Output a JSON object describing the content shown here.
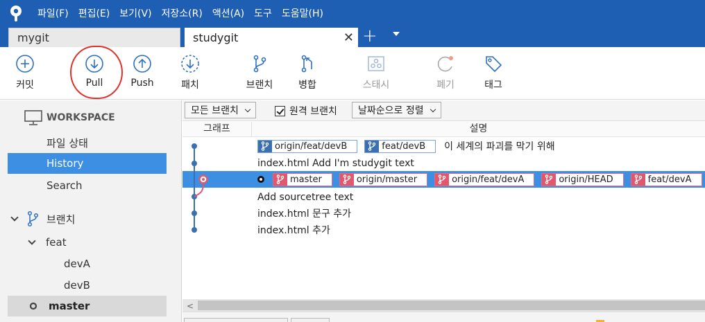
{
  "menu": [
    "파일(F)",
    "편집(E)",
    "보기(V)",
    "저장소(R)",
    "액션(A)",
    "도구",
    "도움말(H)"
  ],
  "tabs": [
    {
      "label": "mygit",
      "active": false
    },
    {
      "label": "studygit",
      "active": true
    }
  ],
  "tab_close_glyph": "✕",
  "tab_add_glyph": "+",
  "toolbar": {
    "commit": "커밋",
    "pull": "Pull",
    "push": "Push",
    "fetch": "패치",
    "branch": "브랜치",
    "merge": "병합",
    "stash": "스태시",
    "discard": "폐기",
    "tag": "태그"
  },
  "sidebar": {
    "workspace": "WORKSPACE",
    "file_status": "파일 상태",
    "history": "History",
    "search": "Search",
    "branches": "브랜치",
    "feat": "feat",
    "devA": "devA",
    "devB": "devB",
    "master": "master"
  },
  "filter": {
    "all_branches": "모든 브랜치",
    "remote_branches": "원격 브랜치",
    "sort": "날짜순으로 정렬"
  },
  "columns": {
    "graph": "그래프",
    "description": "설명"
  },
  "commits": [
    {
      "badges": [
        {
          "label": "origin/feat/devB",
          "color": "blue"
        },
        {
          "label": "feat/devB",
          "color": "blue"
        }
      ],
      "message": "이 세계의 파괴를 막기 위해",
      "selected": false
    },
    {
      "badges": [],
      "message": "index.html Add I'm studygit text",
      "selected": false
    },
    {
      "badges": [
        {
          "label": "master",
          "color": "red"
        },
        {
          "label": "origin/master",
          "color": "red"
        },
        {
          "label": "origin/feat/devA",
          "color": "red"
        },
        {
          "label": "origin/HEAD",
          "color": "red"
        },
        {
          "label": "feat/devA",
          "color": "red"
        }
      ],
      "message": "",
      "selected": true
    },
    {
      "badges": [],
      "message": "Add sourcetree text",
      "selected": false
    },
    {
      "badges": [],
      "message": "index.html 문구 추가",
      "selected": false
    },
    {
      "badges": [],
      "message": "index.html 추가",
      "selected": false
    }
  ],
  "scroll_left_glyph": "<",
  "colors": {
    "brand_blue": "#1e5fb4",
    "selection_blue": "#3d8fe3",
    "branch_badge_blue": "#3a6fb2",
    "branch_badge_red": "#e0586d",
    "annotation_red": "#e0302a"
  }
}
